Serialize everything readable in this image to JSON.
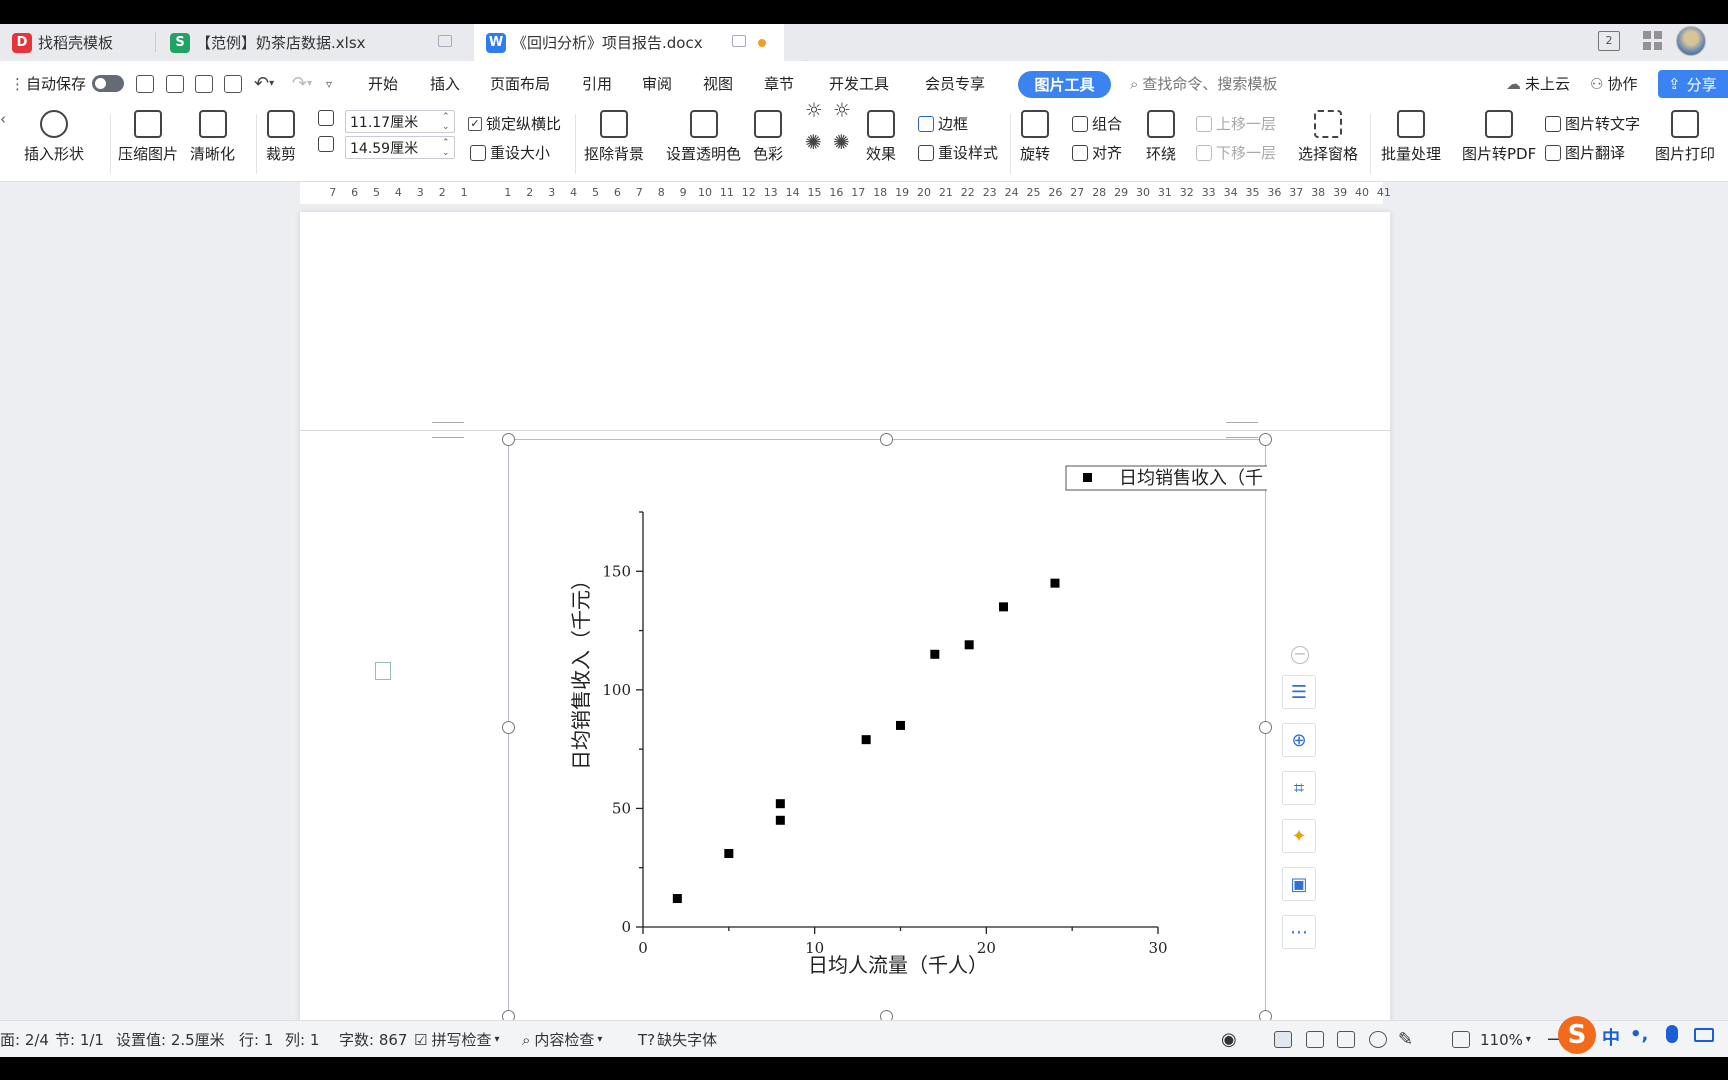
{
  "tabs": [
    {
      "label": "找稻壳模板",
      "icon": "daoke-logo-icon",
      "color": "#e5353b",
      "glyph": "D"
    },
    {
      "label": "【范例】奶茶店数据.xlsx",
      "icon": "wps-spreadsheet-icon",
      "color": "#21a366",
      "glyph": "S"
    },
    {
      "label": "《回归分析》项目报告.docx",
      "icon": "wps-writer-icon",
      "color": "#2d7cf0",
      "glyph": "W"
    }
  ],
  "tabbar_right": {
    "window_count": "2"
  },
  "menubar": {
    "autosave": "自动保存",
    "items": [
      "开始",
      "插入",
      "页面布局",
      "引用",
      "审阅",
      "视图",
      "章节",
      "开发工具",
      "会员专享"
    ],
    "active_tab": "图片工具",
    "search_placeholder": "查找命令、搜索模板",
    "cloud": "未上云",
    "collab": "协作",
    "share": "分享"
  },
  "ribbon": {
    "insert_shape": "插入形状",
    "compress": "压缩图片",
    "sharpen": "清晰化",
    "crop": "裁剪",
    "width": "11.17厘米",
    "height": "14.59厘米",
    "lock_ratio": "锁定纵横比",
    "reset_size": "重设大小",
    "remove_bg": "抠除背景",
    "set_transparent": "设置透明色",
    "color": "色彩",
    "effects": "效果",
    "border": "边框",
    "reset_style": "重设样式",
    "rotate": "旋转",
    "group": "组合",
    "align": "对齐",
    "wrap": "环绕",
    "bring_forward": "上移一层",
    "send_backward": "下移一层",
    "selection_pane": "选择窗格",
    "batch": "批量处理",
    "to_pdf": "图片转PDF",
    "to_text": "图片转文字",
    "translate": "图片翻译",
    "print": "图片打印"
  },
  "ruler": {
    "left_ticks": [
      "7",
      "6",
      "5",
      "4",
      "3",
      "2",
      "1"
    ],
    "right_ticks": [
      "1",
      "2",
      "3",
      "4",
      "5",
      "6",
      "7",
      "8",
      "9",
      "10",
      "11",
      "12",
      "13",
      "14",
      "15",
      "16",
      "17",
      "18",
      "19",
      "20",
      "21",
      "22",
      "23",
      "24",
      "25",
      "26",
      "27",
      "28",
      "29",
      "30",
      "31",
      "32",
      "33",
      "34",
      "35",
      "36",
      "37",
      "38",
      "39",
      "40",
      "41"
    ]
  },
  "chart_data": {
    "type": "scatter",
    "xlabel": "日均人流量（千人）",
    "ylabel": "日均销售收入（千元）",
    "legend": "日均销售收入（千",
    "legend_position": "top-right",
    "xlim": [
      0,
      30
    ],
    "ylim": [
      0,
      175
    ],
    "xticks": [
      0,
      10,
      20,
      30
    ],
    "yticks": [
      0,
      50,
      100,
      150
    ],
    "grid": false,
    "marker": "square",
    "series": [
      {
        "name": "日均销售收入（千",
        "x": [
          2,
          5,
          8,
          8,
          13,
          15,
          17,
          19,
          21,
          24
        ],
        "y": [
          12,
          31,
          45,
          52,
          79,
          85,
          115,
          119,
          135,
          145
        ]
      }
    ]
  },
  "status": {
    "page": "面: 2/4",
    "section": "节: 1/1",
    "setting": "设置值: 2.5厘米",
    "row": "行: 1",
    "col": "列: 1",
    "words": "字数: 867",
    "spell": "拼写检查",
    "content_check": "内容检查",
    "missing_font": "缺失字体",
    "zoom": "110%"
  },
  "ime": {
    "logo": "S",
    "lang": "中",
    "punct": "•,"
  }
}
